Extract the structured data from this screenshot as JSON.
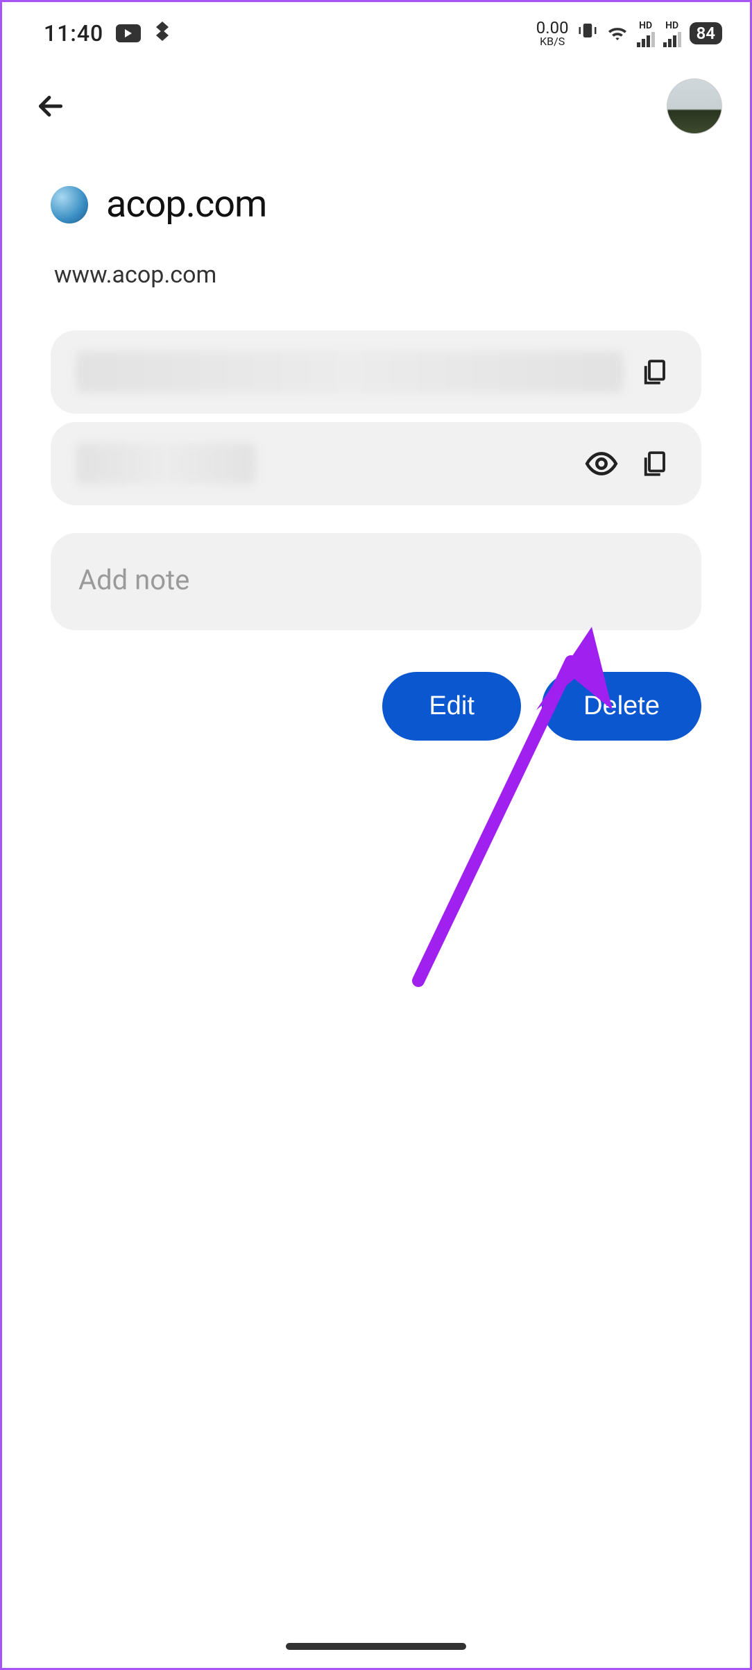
{
  "status": {
    "time": "11:40",
    "data_rate_value": "0.00",
    "data_rate_unit": "KB/S",
    "battery": "84",
    "hd1": "HD",
    "hd2": "HD"
  },
  "site": {
    "name": "acop.com",
    "url": "www.acop.com"
  },
  "note": {
    "placeholder": "Add note"
  },
  "buttons": {
    "edit": "Edit",
    "delete": "Delete"
  }
}
